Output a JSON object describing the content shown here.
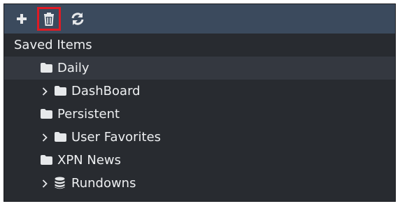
{
  "toolbar": {
    "add_icon": "plus-icon",
    "delete_icon": "trash-icon",
    "refresh_icon": "refresh-icon",
    "highlight_color": "#e01b24"
  },
  "tree": {
    "root_label": "Saved Items",
    "items": [
      {
        "label": "Daily",
        "icon": "folder-icon",
        "expandable": false,
        "selected": true
      },
      {
        "label": "DashBoard",
        "icon": "folder-icon",
        "expandable": true,
        "selected": false
      },
      {
        "label": "Persistent",
        "icon": "folder-icon",
        "expandable": false,
        "selected": false
      },
      {
        "label": "User Favorites",
        "icon": "folder-icon",
        "expandable": true,
        "selected": false
      },
      {
        "label": "XPN News",
        "icon": "folder-icon",
        "expandable": false,
        "selected": false
      },
      {
        "label": "Rundowns",
        "icon": "database-icon",
        "expandable": true,
        "selected": false
      }
    ]
  },
  "colors": {
    "toolbar_bg": "#3b4a5d",
    "tree_bg": "#282b30",
    "selected_row_bg": "#343840",
    "text": "#eef0f2",
    "icon": "#e6e8ea"
  }
}
